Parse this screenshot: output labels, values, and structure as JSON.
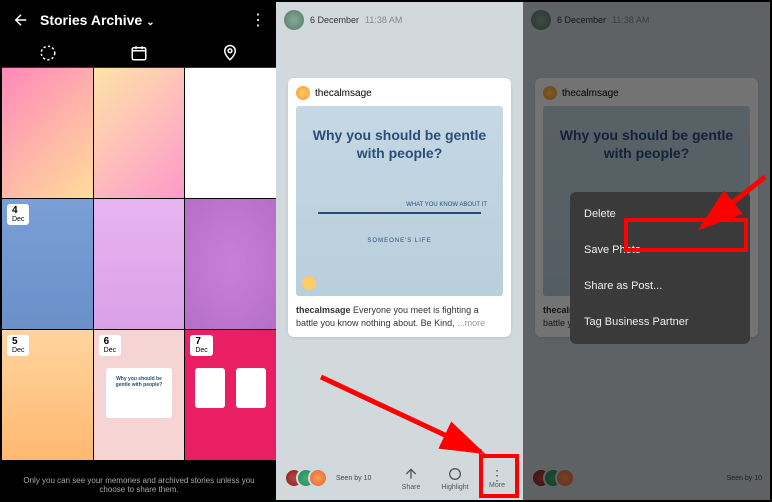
{
  "panel1": {
    "title": "Stories Archive",
    "footer": "Only you can see your memories and archived stories unless you choose to share them.",
    "dates": [
      {
        "day": "4",
        "month": "Dec"
      },
      {
        "day": "5",
        "month": "Dec"
      },
      {
        "day": "6",
        "month": "Dec"
      },
      {
        "day": "7",
        "month": "Dec"
      }
    ],
    "mini_card_title": "Why you should be gentle with people?"
  },
  "story": {
    "date": "6 December",
    "time": "11:38 AM",
    "username": "thecalmsage",
    "card_title": "Why you should be gentle with people?",
    "card_label": "WHAT YOU KNOW ABOUT IT",
    "card_sub": "SOMEONE'S LIFE",
    "caption_user": "thecalmsage",
    "caption_text": " Everyone you meet is fighting a battle you know nothing about. Be Kind,",
    "more": "...more",
    "seen_by": "Seen by 10",
    "actions": {
      "share": "Share",
      "highlight": "Highlight",
      "more": "More"
    }
  },
  "context_menu": {
    "delete": "Delete",
    "save_photo": "Save Photo",
    "share_as_post": "Share as Post...",
    "tag_business": "Tag Business Partner"
  }
}
